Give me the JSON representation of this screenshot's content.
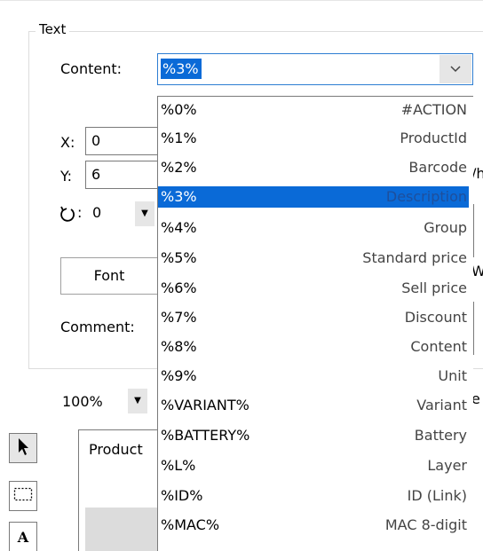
{
  "group": {
    "title": "Text"
  },
  "content": {
    "label": "Content:",
    "selected": "%3%"
  },
  "x": {
    "label": "X:",
    "value": "0"
  },
  "y": {
    "label": "Y:",
    "value": "6"
  },
  "rotation": {
    "value": "0",
    "icon": "rotate-icon"
  },
  "font_button": "Font",
  "comment": {
    "label": "Comment:"
  },
  "zoom": {
    "value": "100%"
  },
  "tab": {
    "label": "Product"
  },
  "peek": {
    "y_right": "/h",
    "font_right": "W",
    "zoom_right": "e"
  },
  "dropdown": {
    "items": [
      {
        "code": "%0%",
        "desc": "#ACTION"
      },
      {
        "code": "%1%",
        "desc": "ProductId"
      },
      {
        "code": "%2%",
        "desc": "Barcode"
      },
      {
        "code": "%3%",
        "desc": "Description",
        "selected": true
      },
      {
        "code": "%4%",
        "desc": "Group"
      },
      {
        "code": "%5%",
        "desc": "Standard price"
      },
      {
        "code": "%6%",
        "desc": "Sell price"
      },
      {
        "code": "%7%",
        "desc": "Discount"
      },
      {
        "code": "%8%",
        "desc": "Content"
      },
      {
        "code": "%9%",
        "desc": "Unit"
      },
      {
        "code": "%VARIANT%",
        "desc": "Variant"
      },
      {
        "code": "%BATTERY%",
        "desc": "Battery"
      },
      {
        "code": "%L%",
        "desc": "Layer"
      },
      {
        "code": "%ID%",
        "desc": "ID (Link)"
      },
      {
        "code": "%MAC%",
        "desc": "MAC 8-digit"
      }
    ]
  },
  "tools": [
    {
      "name": "pointer-tool",
      "icon": "arrow-pointer-icon"
    },
    {
      "name": "select-rect-tool",
      "icon": "dashed-rectangle-icon"
    },
    {
      "name": "text-tool",
      "icon": "text-a-icon"
    }
  ],
  "colors": {
    "selection": "#0a6ad7",
    "border": "#7a7a7a",
    "button_bg": "#e6e6e6"
  }
}
